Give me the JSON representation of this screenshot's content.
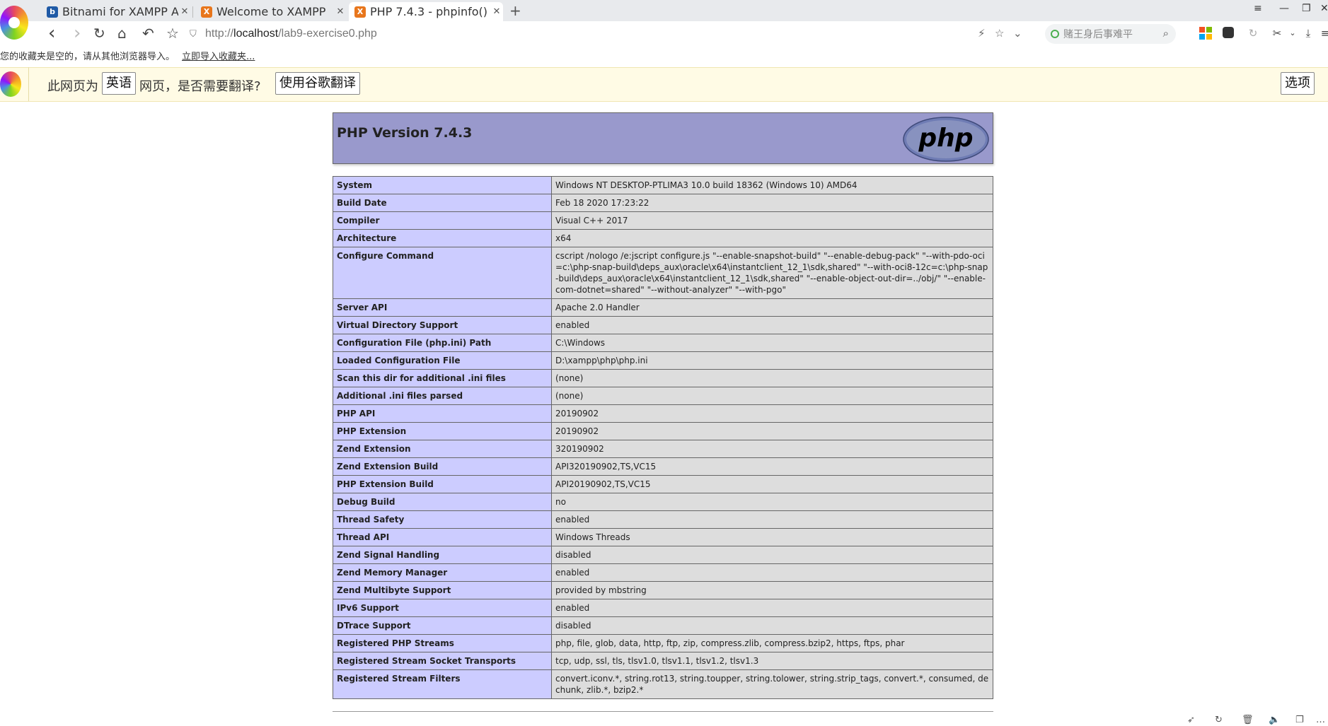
{
  "tabs": [
    {
      "label": "Bitnami for XAMPP Ap",
      "fav": "b",
      "fav_color": "#1f5aa6"
    },
    {
      "label": "Welcome to XAMPP",
      "fav": "X",
      "fav_color": "#e8761c"
    },
    {
      "label": "PHP 7.4.3 - phpinfo()",
      "fav": "X",
      "fav_color": "#e8761c"
    }
  ],
  "icons": {
    "tab_close": "✕",
    "new_tab": "+",
    "back": "‹",
    "forward": "›",
    "reload": "↻",
    "home": "⌂",
    "undo": "↶",
    "star": "☆",
    "lightning": "⚡",
    "chevron": "⌄",
    "magnifier": "⌕",
    "scissors": "✂",
    "download": "⤓",
    "menu": "≡",
    "minimize": "—",
    "restore": "❐",
    "close": "✕",
    "shield": "⛉"
  },
  "address": {
    "prefix": "http://",
    "host": "localhost",
    "path": "/lab9-exercise0.php"
  },
  "search": {
    "placeholder": "赌王身后事难平"
  },
  "bookmarks": {
    "empty_text": "您的收藏夹是空的，请从其他浏览器导入。",
    "import_link": "立即导入收藏夹..."
  },
  "translate": {
    "prefix": "此网页为",
    "language": "英语",
    "question": "网页，是否需要翻译?",
    "translate_button": "使用谷歌翻译",
    "options_button": "选项"
  },
  "php": {
    "version_title": "PHP Version 7.4.3",
    "logo_text": "php",
    "rows": [
      {
        "key": "System",
        "value": "Windows NT DESKTOP-PTLIMA3 10.0 build 18362 (Windows 10) AMD64"
      },
      {
        "key": "Build Date",
        "value": "Feb 18 2020 17:23:22"
      },
      {
        "key": "Compiler",
        "value": "Visual C++ 2017"
      },
      {
        "key": "Architecture",
        "value": "x64"
      },
      {
        "key": "Configure Command",
        "value": "cscript /nologo /e:jscript configure.js \"--enable-snapshot-build\" \"--enable-debug-pack\" \"--with-pdo-oci=c:\\php-snap-build\\deps_aux\\oracle\\x64\\instantclient_12_1\\sdk,shared\" \"--with-oci8-12c=c:\\php-snap-build\\deps_aux\\oracle\\x64\\instantclient_12_1\\sdk,shared\" \"--enable-object-out-dir=../obj/\" \"--enable-com-dotnet=shared\" \"--without-analyzer\" \"--with-pgo\""
      },
      {
        "key": "Server API",
        "value": "Apache 2.0 Handler"
      },
      {
        "key": "Virtual Directory Support",
        "value": "enabled"
      },
      {
        "key": "Configuration File (php.ini) Path",
        "value": "C:\\Windows"
      },
      {
        "key": "Loaded Configuration File",
        "value": "D:\\xampp\\php\\php.ini"
      },
      {
        "key": "Scan this dir for additional .ini files",
        "value": "(none)"
      },
      {
        "key": "Additional .ini files parsed",
        "value": "(none)"
      },
      {
        "key": "PHP API",
        "value": "20190902"
      },
      {
        "key": "PHP Extension",
        "value": "20190902"
      },
      {
        "key": "Zend Extension",
        "value": "320190902"
      },
      {
        "key": "Zend Extension Build",
        "value": "API320190902,TS,VC15"
      },
      {
        "key": "PHP Extension Build",
        "value": "API20190902,TS,VC15"
      },
      {
        "key": "Debug Build",
        "value": "no"
      },
      {
        "key": "Thread Safety",
        "value": "enabled"
      },
      {
        "key": "Thread API",
        "value": "Windows Threads"
      },
      {
        "key": "Zend Signal Handling",
        "value": "disabled"
      },
      {
        "key": "Zend Memory Manager",
        "value": "enabled"
      },
      {
        "key": "Zend Multibyte Support",
        "value": "provided by mbstring"
      },
      {
        "key": "IPv6 Support",
        "value": "enabled"
      },
      {
        "key": "DTrace Support",
        "value": "disabled"
      },
      {
        "key": "Registered PHP Streams",
        "value": "php, file, glob, data, http, ftp, zip, compress.zlib, compress.bzip2, https, ftps, phar"
      },
      {
        "key": "Registered Stream Socket Transports",
        "value": "tcp, udp, ssl, tls, tlsv1.0, tlsv1.1, tlsv1.2, tlsv1.3"
      },
      {
        "key": "Registered Stream Filters",
        "value": "convert.iconv.*, string.rot13, string.toupper, string.tolower, string.strip_tags, convert.*, consumed, dechunk, zlib.*, bzip2.*"
      }
    ]
  }
}
